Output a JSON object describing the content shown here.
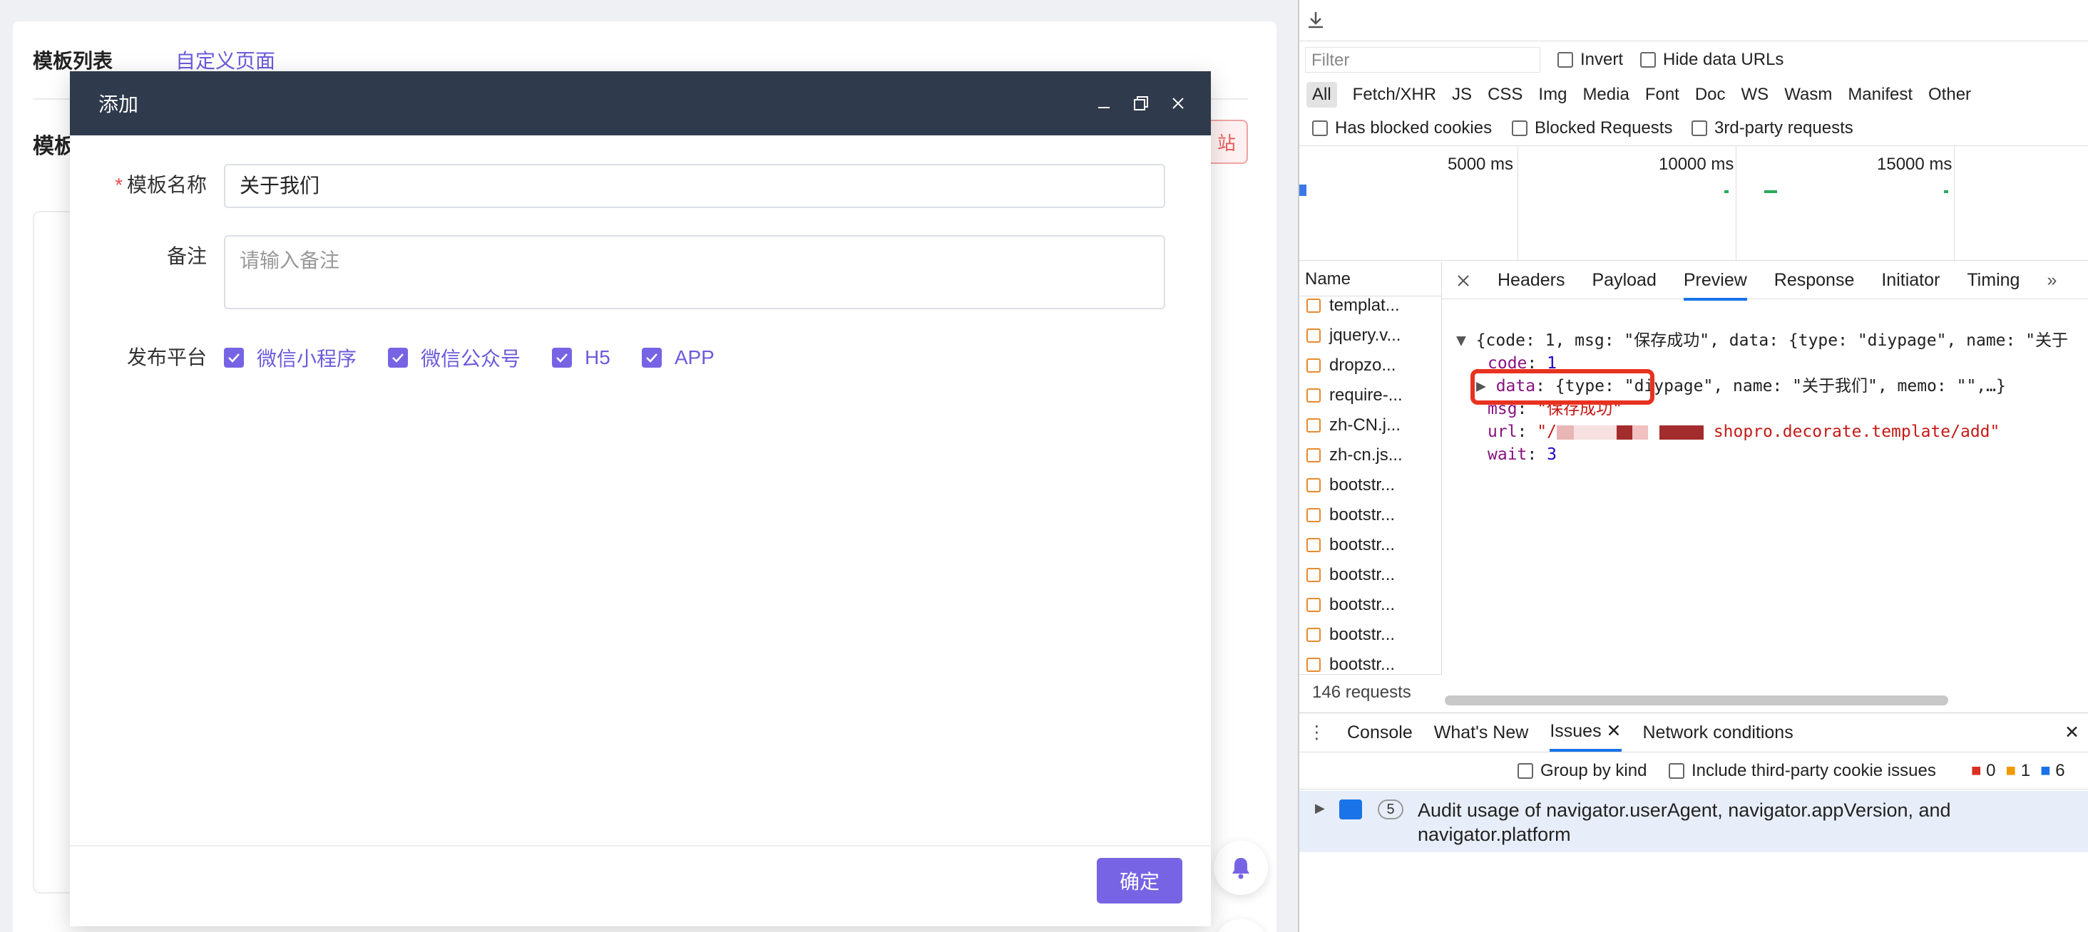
{
  "app": {
    "tabs": [
      "模板列表",
      "自定义页面"
    ],
    "bg_title": "模板",
    "bg_button": "站"
  },
  "modal": {
    "title": "添加",
    "fields": {
      "name_label": "模板名称",
      "name_required": "*",
      "name_value": "关于我们",
      "memo_label": "备注",
      "memo_placeholder": "请输入备注",
      "platform_label": "发布平台",
      "platforms": [
        "微信小程序",
        "微信公众号",
        "H5",
        "APP"
      ]
    },
    "ok": "确定"
  },
  "devtools": {
    "filter_placeholder": "Filter",
    "invert": "Invert",
    "hide_data_urls": "Hide data URLs",
    "types": [
      "All",
      "Fetch/XHR",
      "JS",
      "CSS",
      "Img",
      "Media",
      "Font",
      "Doc",
      "WS",
      "Wasm",
      "Manifest",
      "Other"
    ],
    "blocked_cookies": "Has blocked cookies",
    "blocked_requests": "Blocked Requests",
    "third_party": "3rd-party requests",
    "timeline": [
      "5000 ms",
      "10000 ms",
      "15000 ms"
    ],
    "name_header": "Name",
    "names": [
      "templat...",
      "jquery.v...",
      "dropzo...",
      "require-...",
      "zh-CN.j...",
      "zh-cn.js...",
      "bootstr...",
      "bootstr...",
      "bootstr...",
      "bootstr...",
      "bootstr...",
      "bootstr...",
      "bootstr..."
    ],
    "req_count": "146 requests",
    "preview_tabs": [
      "Headers",
      "Payload",
      "Preview",
      "Response",
      "Initiator",
      "Timing"
    ],
    "json": {
      "line1": "{code: 1, msg: \"保存成功\", data: {type: \"diypage\", name: \"关于",
      "code": "1",
      "data": "{type: \"diypage\", name: \"关于我们\", memo: \"\",…}",
      "msg": "\"保存成功\"",
      "url": "shopro.decorate.template/add\"",
      "wait": "3"
    },
    "drawer_tabs": [
      "Console",
      "What's New",
      "Issues",
      "Network conditions"
    ],
    "group_by_kind": "Group by kind",
    "include_third": "Include third-party cookie issues",
    "counts": [
      "0",
      "1",
      "6"
    ],
    "issue_count": "5",
    "issue_text": "Audit usage of navigator.userAgent, navigator.appVersion, and navigator.platform"
  }
}
